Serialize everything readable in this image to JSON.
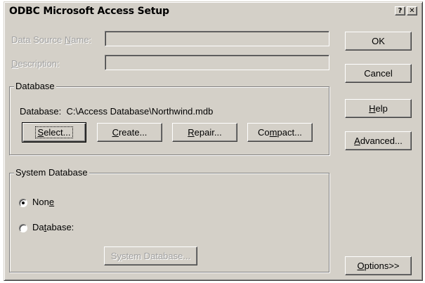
{
  "window": {
    "title": "ODBC Microsoft Access Setup",
    "help_glyph": "?",
    "close_glyph": "✕"
  },
  "fields": {
    "dsn_label_pre": "Data Source ",
    "dsn_label_key": "N",
    "dsn_label_post": "ame:",
    "dsn_value": "",
    "desc_label_key": "D",
    "desc_label_post": "escription:",
    "desc_value": ""
  },
  "database_group": {
    "title": "Database",
    "path_label": "Database:",
    "path_value": "C:\\Access Database\\Northwind.mdb",
    "select_key": "S",
    "select_rest": "elect...",
    "create_key": "C",
    "create_rest": "reate...",
    "repair_key": "R",
    "repair_rest": "epair...",
    "compact_pre": "Co",
    "compact_key": "m",
    "compact_rest": "pact..."
  },
  "system_db_group": {
    "title": "System Database",
    "none_pre": "Non",
    "none_key": "e",
    "none_selected": true,
    "database_pre": "Da",
    "database_key": "t",
    "database_rest": "abase:",
    "sysdb_btn_pre": "S",
    "sysdb_btn_key": "y",
    "sysdb_btn_rest": "stem Database..."
  },
  "side_buttons": {
    "ok": "OK",
    "cancel": "Cancel",
    "help_key": "H",
    "help_rest": "elp",
    "advanced_key": "A",
    "advanced_rest": "dvanced...",
    "options_key": "O",
    "options_rest": "ptions>>"
  },
  "icons": {
    "help": "question-mark-icon",
    "close": "close-icon",
    "radio_selected": "radio-selected-icon",
    "radio_unselected": "radio-unselected-icon"
  }
}
